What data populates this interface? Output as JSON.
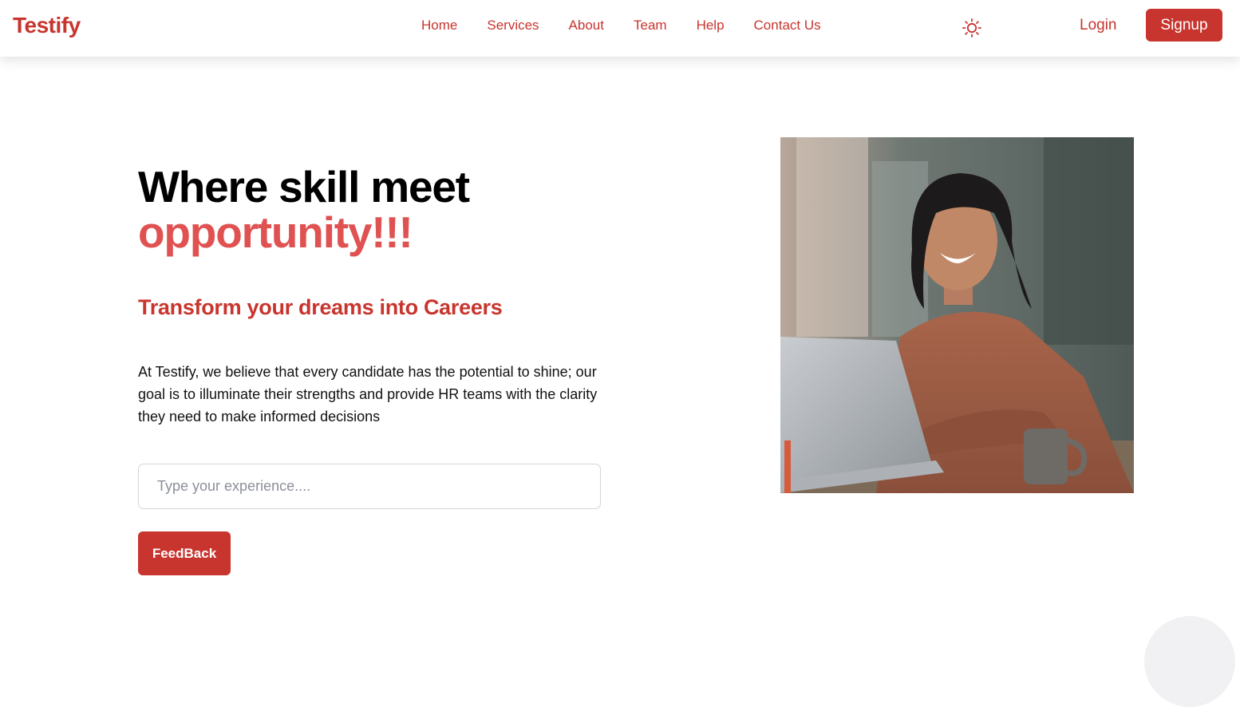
{
  "nav": {
    "brand": "Testify",
    "links": [
      "Home",
      "Services",
      "About",
      "Team",
      "Help",
      "Contact Us"
    ],
    "theme_icon": "sun-icon",
    "login": "Login",
    "signup": "Signup"
  },
  "hero": {
    "title_line1": "Where skill meet",
    "title_line2": "opportunity!!!",
    "subtitle": "Transform your dreams into Careers",
    "description": "At Testify, we believe that every candidate has the potential to shine; our goal is to illuminate their strengths and provide HR teams with the clarity they need to make informed decisions",
    "input_placeholder": "Type your experience....",
    "input_value": "",
    "feedback_button": "FeedBack"
  },
  "colors": {
    "brand": "#c8352e",
    "accent_title": "#e05252"
  }
}
